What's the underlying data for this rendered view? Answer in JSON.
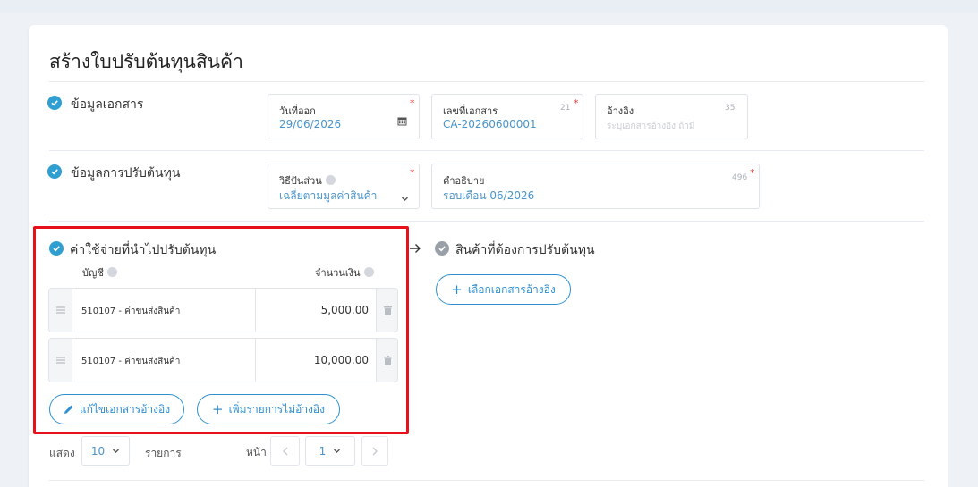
{
  "page": {
    "title": "สร้างใบปรับต้นทุนสินค้า"
  },
  "sections": {
    "doc_info": "ข้อมูลเอกสาร",
    "adjust_info": "ข้อมูลการปรับต้นทุน",
    "expenses": "ค่าใช้จ่ายที่นำไปปรับต้นทุน",
    "products": "สินค้าที่ต้องการปรับต้นทุน"
  },
  "fields": {
    "issue_date": {
      "label": "วันที่ออก",
      "value": "29/06/2026"
    },
    "doc_no": {
      "label": "เลขที่เอกสาร",
      "value": "CA-20260600001",
      "counter": "21"
    },
    "reference": {
      "label": "อ้างอิง",
      "placeholder": "ระบุเอกสารอ้างอิง ถ้ามี",
      "counter": "35"
    },
    "method": {
      "label": "วิธีปันส่วน",
      "value": "เฉลี่ยตามมูลค่าสินค้า"
    },
    "description": {
      "label": "คำอธิบาย",
      "value": "รอบเดือน 06/2026",
      "counter": "496"
    }
  },
  "expense_table": {
    "col_account": "บัญชี",
    "col_amount": "จำนวนเงิน",
    "rows": [
      {
        "account": "510107 - ค่าขนส่งสินค้า",
        "amount": "5,000.00"
      },
      {
        "account": "510107 - ค่าขนส่งสินค้า",
        "amount": "10,000.00"
      }
    ]
  },
  "buttons": {
    "edit_ref": "แก้ไขเอกสารอ้างอิง",
    "add_no_ref": "เพิ่มรายการไม่อ้างอิง",
    "select_ref": "เลือกเอกสารอ้างอิง"
  },
  "pagination": {
    "show_label": "แสดง",
    "per_page": "10",
    "items_label": "รายการ",
    "page_label": "หน้า",
    "page": "1"
  },
  "colors": {
    "accent": "#2e8fd0",
    "highlight": "#e8101a",
    "required": "#e03b3b"
  }
}
